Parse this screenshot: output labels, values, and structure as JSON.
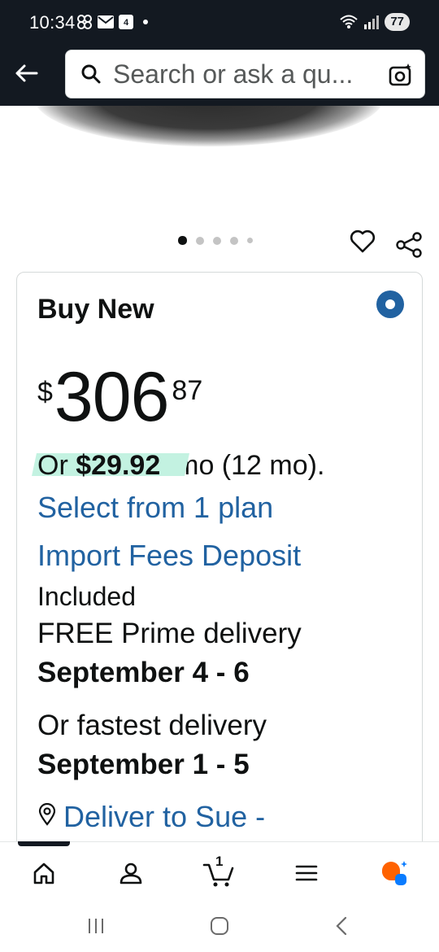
{
  "status_bar": {
    "time": "10:34",
    "battery": "77",
    "calendar_badge": "4"
  },
  "header": {
    "search_placeholder": "Search or ask a qu..."
  },
  "gallery": {
    "page_count": 5,
    "active_index": 0
  },
  "buy_box": {
    "title": "Buy New",
    "price_symbol": "$",
    "price_whole": "306",
    "price_fraction": "87",
    "installment_prefix": "Or",
    "installment_amount": "$29.92",
    "installment_suffix": " /mo (12 mo).",
    "select_plan_link": "Select from 1 plan",
    "import_fees_link": "Import Fees Deposit",
    "import_fees_status": "Included",
    "free_delivery": "FREE Prime delivery",
    "free_delivery_date": "September 4 - 6",
    "fastest_delivery": "Or fastest delivery",
    "fastest_delivery_date": "September 1 - 5",
    "deliver_to_link": "Deliver to Sue -"
  },
  "bottom_nav": {
    "cart_count": "1",
    "items": [
      {
        "name": "home",
        "icon": "home-icon"
      },
      {
        "name": "account",
        "icon": "person-icon"
      },
      {
        "name": "cart",
        "icon": "cart-icon"
      },
      {
        "name": "menu",
        "icon": "hamburger-icon"
      },
      {
        "name": "rufus",
        "icon": "assistant-icon"
      }
    ]
  },
  "colors": {
    "header_bg": "#131921",
    "link": "#2162a1",
    "highlight": "#c3f2e1",
    "assistant_orange": "#ff6200",
    "assistant_blue": "#0a7cff"
  }
}
